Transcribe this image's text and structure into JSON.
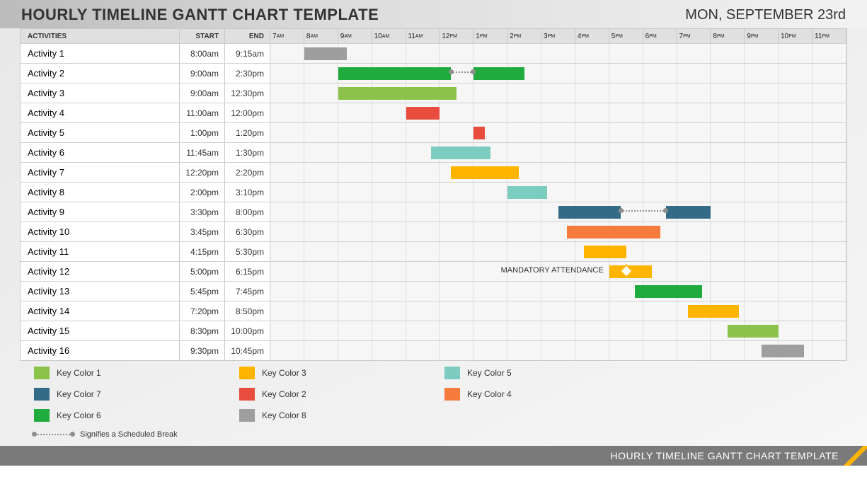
{
  "title": "HOURLY TIMELINE GANTT CHART TEMPLATE",
  "date": "MON, SEPTEMBER 23rd",
  "footer": "HOURLY TIMELINE GANTT CHART TEMPLATE",
  "headers": {
    "activities": "ACTIVITIES",
    "start": "START",
    "end": "END"
  },
  "hours": [
    "7",
    "8",
    "9",
    "10",
    "11",
    "12",
    "1",
    "2",
    "3",
    "4",
    "5",
    "6",
    "7",
    "8",
    "9",
    "10",
    "11"
  ],
  "ampm": [
    "AM",
    "AM",
    "AM",
    "AM",
    "AM",
    "PM",
    "PM",
    "PM",
    "PM",
    "PM",
    "PM",
    "PM",
    "PM",
    "PM",
    "PM",
    "PM",
    "PM"
  ],
  "legend": [
    {
      "label": "Key Color 1",
      "color": "#8bc34a"
    },
    {
      "label": "Key Color 3",
      "color": "#ffb400"
    },
    {
      "label": "Key Color 5",
      "color": "#7dccc0"
    },
    {
      "label": "Key Color 7",
      "color": "#336b87"
    },
    {
      "label": "Key Color 2",
      "color": "#e84c3d"
    },
    {
      "label": "Key Color 4",
      "color": "#f57c3c"
    },
    {
      "label": "Key Color 6",
      "color": "#1fab3d"
    },
    {
      "label": "Key Color 8",
      "color": "#9e9e9e"
    }
  ],
  "break_legend": "Signifies a Scheduled Break",
  "annotation_12": "MANDATORY ATTENDANCE",
  "chart_data": {
    "type": "gantt",
    "time_axis_start_hour": 7,
    "time_axis_end_hour": 24,
    "activities": [
      {
        "name": "Activity 1",
        "start": "8:00am",
        "end": "9:15am",
        "segments": [
          {
            "from": 8.0,
            "to": 9.25,
            "color": "#9e9e9e"
          }
        ]
      },
      {
        "name": "Activity 2",
        "start": "9:00am",
        "end": "2:30pm",
        "segments": [
          {
            "from": 9.0,
            "to": 12.33,
            "color": "#1fab3d"
          },
          {
            "from": 13.0,
            "to": 14.5,
            "color": "#1fab3d"
          }
        ],
        "break": {
          "from": 12.33,
          "to": 13.0
        }
      },
      {
        "name": "Activity 3",
        "start": "9:00am",
        "end": "12:30pm",
        "segments": [
          {
            "from": 9.0,
            "to": 12.5,
            "color": "#8bc34a"
          }
        ]
      },
      {
        "name": "Activity 4",
        "start": "11:00am",
        "end": "12:00pm",
        "segments": [
          {
            "from": 11.0,
            "to": 12.0,
            "color": "#e84c3d"
          }
        ]
      },
      {
        "name": "Activity 5",
        "start": "1:00pm",
        "end": "1:20pm",
        "segments": [
          {
            "from": 13.0,
            "to": 13.33,
            "color": "#e84c3d"
          }
        ]
      },
      {
        "name": "Activity 6",
        "start": "11:45am",
        "end": "1:30pm",
        "segments": [
          {
            "from": 11.75,
            "to": 13.5,
            "color": "#7dccc0"
          }
        ]
      },
      {
        "name": "Activity 7",
        "start": "12:20pm",
        "end": "2:20pm",
        "segments": [
          {
            "from": 12.33,
            "to": 14.33,
            "color": "#ffb400"
          }
        ]
      },
      {
        "name": "Activity 8",
        "start": "2:00pm",
        "end": "3:10pm",
        "segments": [
          {
            "from": 14.0,
            "to": 15.17,
            "color": "#7dccc0"
          }
        ]
      },
      {
        "name": "Activity 9",
        "start": "3:30pm",
        "end": "8:00pm",
        "segments": [
          {
            "from": 15.5,
            "to": 17.33,
            "color": "#336b87"
          },
          {
            "from": 18.67,
            "to": 20.0,
            "color": "#336b87"
          }
        ],
        "break": {
          "from": 17.33,
          "to": 18.67
        }
      },
      {
        "name": "Activity 10",
        "start": "3:45pm",
        "end": "6:30pm",
        "segments": [
          {
            "from": 15.75,
            "to": 18.5,
            "color": "#f57c3c"
          }
        ]
      },
      {
        "name": "Activity 11",
        "start": "4:15pm",
        "end": "5:30pm",
        "segments": [
          {
            "from": 16.25,
            "to": 17.5,
            "color": "#ffb400"
          }
        ]
      },
      {
        "name": "Activity 12",
        "start": "5:00pm",
        "end": "6:15pm",
        "segments": [
          {
            "from": 17.0,
            "to": 18.25,
            "color": "#ffb400"
          }
        ],
        "annotation": "MANDATORY ATTENDANCE",
        "milestone": 17.5
      },
      {
        "name": "Activity 13",
        "start": "5:45pm",
        "end": "7:45pm",
        "segments": [
          {
            "from": 17.75,
            "to": 19.75,
            "color": "#1fab3d"
          }
        ]
      },
      {
        "name": "Activity 14",
        "start": "7:20pm",
        "end": "8:50pm",
        "segments": [
          {
            "from": 19.33,
            "to": 20.83,
            "color": "#ffb400"
          }
        ]
      },
      {
        "name": "Activity 15",
        "start": "8:30pm",
        "end": "10:00pm",
        "segments": [
          {
            "from": 20.5,
            "to": 22.0,
            "color": "#8bc34a"
          }
        ]
      },
      {
        "name": "Activity 16",
        "start": "9:30pm",
        "end": "10:45pm",
        "segments": [
          {
            "from": 21.5,
            "to": 22.75,
            "color": "#9e9e9e"
          }
        ]
      }
    ]
  }
}
